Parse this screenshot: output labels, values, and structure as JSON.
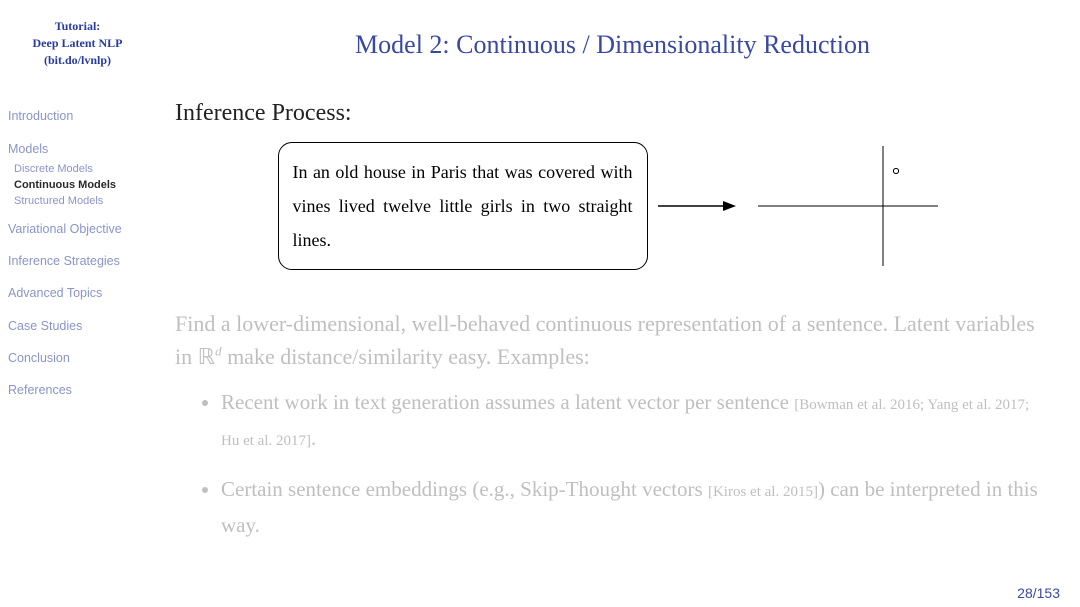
{
  "sidebar": {
    "title_l1": "Tutorial:",
    "title_l2": "Deep Latent NLP",
    "title_l3": "(bit.do/lvnlp)",
    "nav": {
      "intro": "Introduction",
      "models": "Models",
      "models_sub": {
        "discrete": "Discrete Models",
        "continuous": "Continuous Models",
        "structured": "Structured Models"
      },
      "variational": "Variational Objective",
      "inference": "Inference Strategies",
      "advanced": "Advanced Topics",
      "case": "Case Studies",
      "conclusion": "Conclusion",
      "references": "References"
    }
  },
  "main": {
    "title": "Model 2: Continuous / Dimensionality Reduction",
    "section": "Inference Process:",
    "sentence": "In an old house in Paris that was covered with vines lived twelve little girls in two straight lines.",
    "body_p1_a": "Find a lower-dimensional, well-behaved continuous representation of a sentence. Latent variables in ",
    "body_p1_R": "ℝ",
    "body_p1_d": "d",
    "body_p1_b": " make distance/similarity easy. Examples:",
    "bullet1_a": "Recent work in text generation assumes a latent vector per sentence ",
    "bullet1_cite": "[Bowman et al. 2016; Yang et al. 2017; Hu et al. 2017]",
    "bullet1_b": ".",
    "bullet2_a": "Certain sentence embeddings (e.g., Skip-Thought vectors ",
    "bullet2_cite": "[Kiros et al. 2015]",
    "bullet2_b": ") can be interpreted in this way."
  },
  "page": "28/153"
}
